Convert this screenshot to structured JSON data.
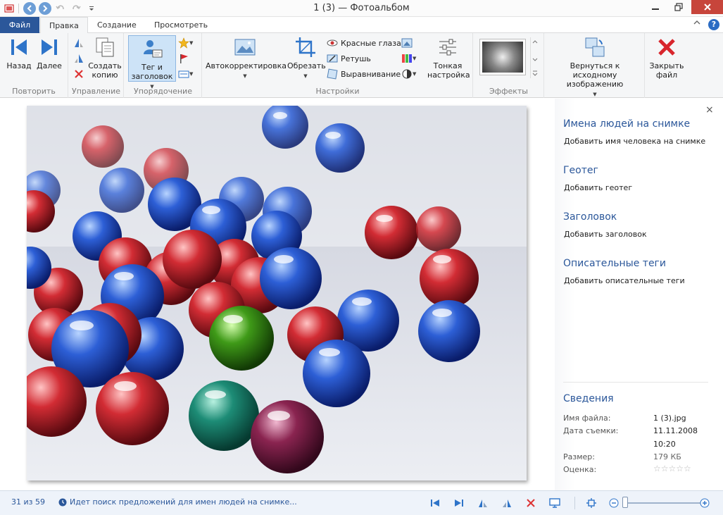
{
  "window": {
    "title": "1 (3) — Фотоальбом"
  },
  "tabs": [
    {
      "label": "Файл"
    },
    {
      "label": "Правка"
    },
    {
      "label": "Создание"
    },
    {
      "label": "Просмотреть"
    }
  ],
  "help_label": "?",
  "ribbon": {
    "repeat": {
      "label": "Повторить",
      "back": "Назад",
      "forward": "Далее"
    },
    "manage": {
      "label": "Управление",
      "copy": "Создать копию"
    },
    "organize": {
      "label": "Упорядочение",
      "tag": "Тег и заголовок"
    },
    "settings": {
      "label": "Настройки",
      "autocorrect": "Автокорректировка",
      "crop": "Обрезать",
      "redeye": "Красные глаза",
      "retouch": "Ретушь",
      "straighten": "Выравнивание",
      "fine_tune": "Тонкая настройка"
    },
    "effects": {
      "label": "Эффекты"
    },
    "revert": {
      "label": "Вернуться к исходному изображению"
    },
    "close_file": {
      "label": "Закрыть файл"
    }
  },
  "panel": {
    "people_title": "Имена людей на снимке",
    "people_add": "Добавить имя человека на снимке",
    "geotag_title": "Геотег",
    "geotag_add": "Добавить геотег",
    "caption_title": "Заголовок",
    "caption_add": "Добавить заголовок",
    "tags_title": "Описательные теги",
    "tags_add": "Добавить описательные теги",
    "info_title": "Сведения",
    "info": {
      "filename_label": "Имя файла:",
      "filename_value": "1 (3).jpg",
      "date_label": "Дата съемки:",
      "date_value": "11.11.2008",
      "time_value": "10:20",
      "size_label": "Размер:",
      "size_value": "179 КБ",
      "rating_label": "Оценка:",
      "rating_stars": "☆☆☆☆☆"
    },
    "close_glyph": "×"
  },
  "status": {
    "count": "31 из 59",
    "message": "Идет поиск предложений для имен людей на снимке..."
  },
  "colors": {
    "accent": "#2b579a",
    "close_red": "#c7453b",
    "ribbon_bg": "#f5f6f7"
  }
}
